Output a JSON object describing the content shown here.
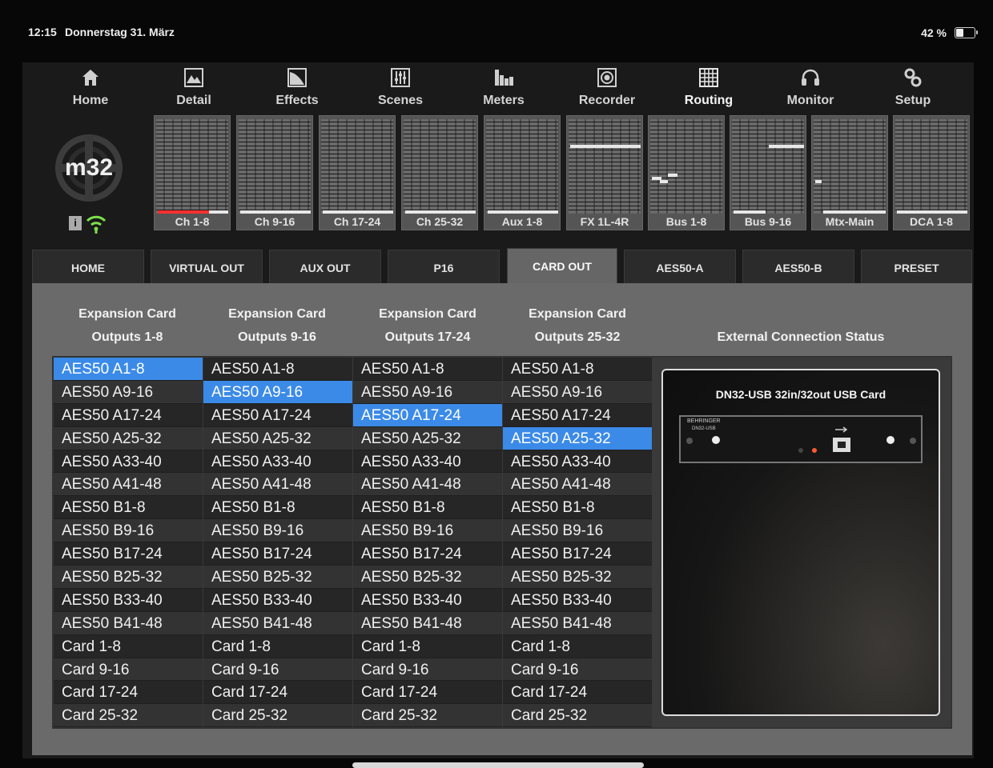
{
  "statusbar": {
    "time": "12:15",
    "date": "Donnerstag 31. März",
    "battery": "42 %"
  },
  "nav": [
    {
      "label": "Home",
      "icon": "home-icon"
    },
    {
      "label": "Detail",
      "icon": "detail-icon"
    },
    {
      "label": "Effects",
      "icon": "effects-icon"
    },
    {
      "label": "Scenes",
      "icon": "scenes-icon"
    },
    {
      "label": "Meters",
      "icon": "meters-icon"
    },
    {
      "label": "Recorder",
      "icon": "recorder-icon"
    },
    {
      "label": "Routing",
      "icon": "routing-icon"
    },
    {
      "label": "Monitor",
      "icon": "headphones-icon"
    },
    {
      "label": "Setup",
      "icon": "setup-gears-icon"
    }
  ],
  "nav_active": "Routing",
  "logo_text": "m32",
  "strips": [
    {
      "label": "Ch 1-8"
    },
    {
      "label": "Ch 9-16"
    },
    {
      "label": "Ch 17-24"
    },
    {
      "label": "Ch 25-32"
    },
    {
      "label": "Aux 1-8"
    },
    {
      "label": "FX 1L-4R"
    },
    {
      "label": "Bus 1-8"
    },
    {
      "label": "Bus 9-16"
    },
    {
      "label": "Mtx-Main"
    },
    {
      "label": "DCA 1-8"
    }
  ],
  "tabs": [
    "HOME",
    "VIRTUAL OUT",
    "AUX OUT",
    "P16",
    "CARD OUT",
    "AES50-A",
    "AES50-B",
    "PRESET"
  ],
  "tab_active": "CARD OUT",
  "headers": {
    "col1": [
      "Expansion Card",
      "Outputs 1-8"
    ],
    "col2": [
      "Expansion Card",
      "Outputs 9-16"
    ],
    "col3": [
      "Expansion Card",
      "Outputs 17-24"
    ],
    "col4": [
      "Expansion Card",
      "Outputs 25-32"
    ],
    "status": "External Connection Status"
  },
  "options": [
    "AES50 A1-8",
    "AES50 A9-16",
    "AES50 A17-24",
    "AES50 A25-32",
    "AES50 A33-40",
    "AES50 A41-48",
    "AES50 B1-8",
    "AES50 B9-16",
    "AES50 B17-24",
    "AES50 B25-32",
    "AES50 B33-40",
    "AES50 B41-48",
    "Card 1-8",
    "Card 9-16",
    "Card 17-24",
    "Card 25-32"
  ],
  "selected": [
    "AES50 A1-8",
    "AES50 A9-16",
    "AES50 A17-24",
    "AES50 A25-32"
  ],
  "card": {
    "title": "DN32-USB 32in/32out USB Card",
    "brand": "BEHRINGER",
    "model": "DN32-USB"
  },
  "colors": {
    "selection": "#3b8ae8",
    "panel": "#6a6a6a",
    "active_indicator": "#7ee04a",
    "meter_red": "#ff3030"
  }
}
